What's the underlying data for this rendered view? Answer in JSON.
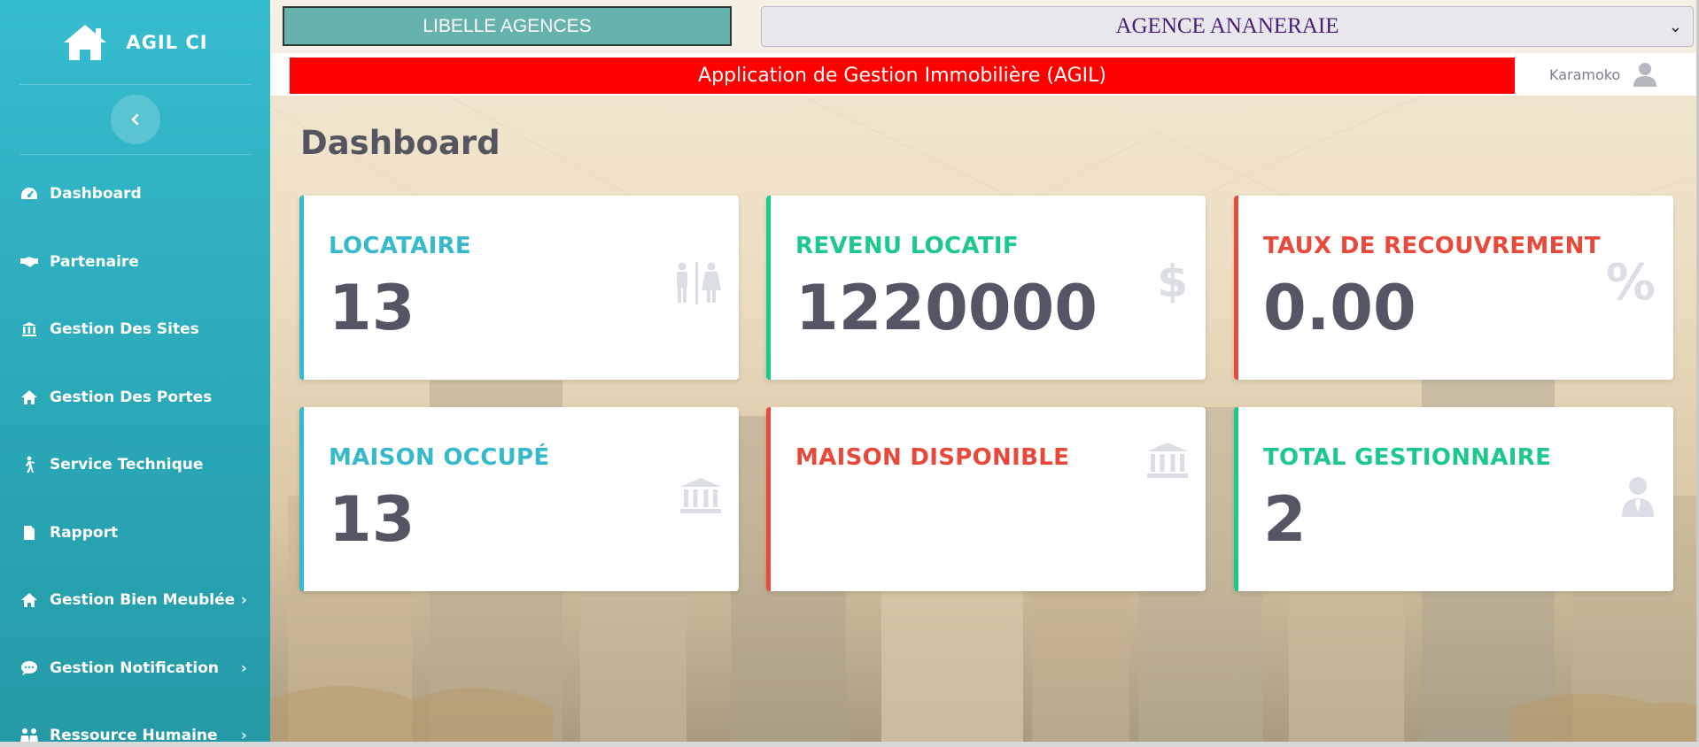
{
  "sidebar": {
    "brand": "AGIL CI",
    "items": [
      {
        "label": "Dashboard",
        "icon": "gauge-icon",
        "has_submenu": false
      },
      {
        "label": "Partenaire",
        "icon": "handshake-icon",
        "has_submenu": false
      },
      {
        "label": "Gestion Des Sites",
        "icon": "bank-icon",
        "has_submenu": false
      },
      {
        "label": "Gestion Des Portes",
        "icon": "home-icon",
        "has_submenu": false
      },
      {
        "label": "Service Technique",
        "icon": "person-walking-icon",
        "has_submenu": false
      },
      {
        "label": "Rapport",
        "icon": "file-icon",
        "has_submenu": false
      },
      {
        "label": "Gestion Bien Meublée",
        "icon": "home-icon",
        "has_submenu": true
      },
      {
        "label": "Gestion Notification",
        "icon": "comment-icon",
        "has_submenu": true
      },
      {
        "label": "Ressource Humaine",
        "icon": "people-icon",
        "has_submenu": true
      }
    ]
  },
  "topbar": {
    "agences_label": "LIBELLE AGENCES",
    "agence_selected": "AGENCE ANANERAIE"
  },
  "header": {
    "banner": "Application de Gestion Immobilière (AGIL)",
    "username": "Karamoko"
  },
  "page": {
    "title": "Dashboard"
  },
  "cards": [
    {
      "label": "LOCATAIRE",
      "value": "13",
      "icon": "restroom-icon"
    },
    {
      "label": "REVENU LOCATIF",
      "value": "1220000",
      "icon": "dollar-icon"
    },
    {
      "label": "TAUX DE RECOUVREMENT",
      "value": "0.00",
      "icon": "percent-icon"
    },
    {
      "label": "MAISON OCCUPÉ",
      "value": "13",
      "icon": "bank-icon"
    },
    {
      "label": "MAISON DISPONIBLE",
      "value": "",
      "icon": "bank-icon"
    },
    {
      "label": "TOTAL GESTIONNAIRE",
      "value": "2",
      "icon": "user-tie-icon"
    }
  ],
  "colors": {
    "sidebar": "#36bcd0",
    "info": "#36b9cc",
    "success": "#1cc88a",
    "danger": "#e74a3b",
    "banner": "#ff0000",
    "agences_button": "#66b2ad",
    "select_text": "#4a1c76"
  }
}
